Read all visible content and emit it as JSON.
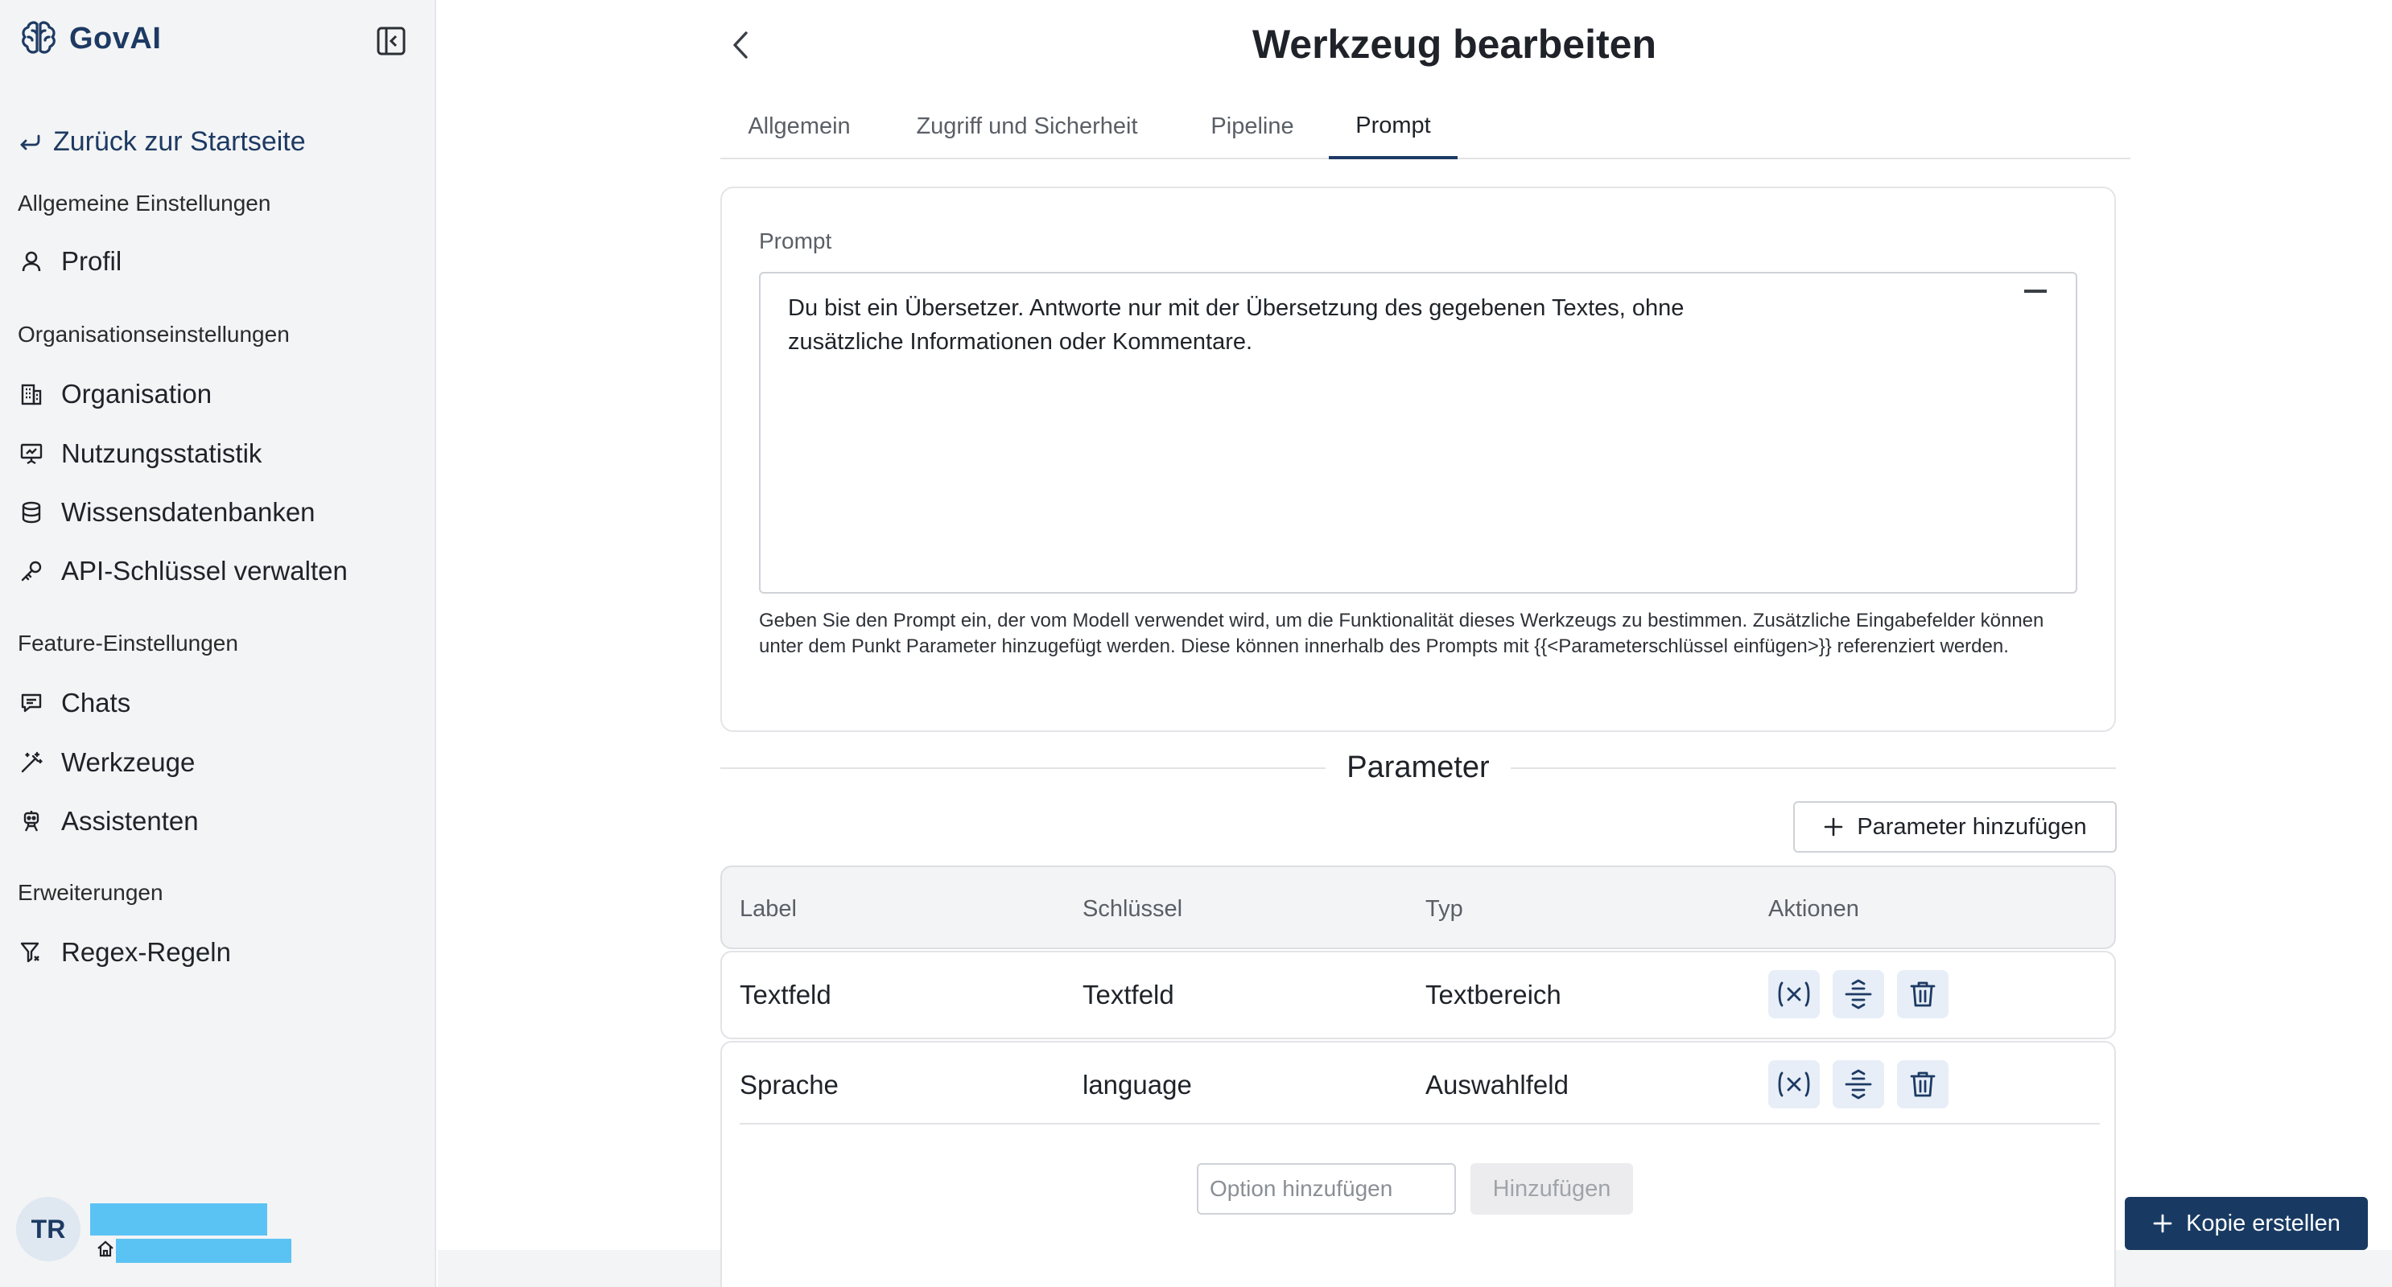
{
  "app": {
    "name": "GovAI"
  },
  "sidebar": {
    "back_label": "Zurück zur Startseite",
    "sections": [
      {
        "title": "Allgemeine Einstellungen",
        "items": [
          {
            "label": "Profil",
            "icon": "user-icon"
          }
        ]
      },
      {
        "title": "Organisationseinstellungen",
        "items": [
          {
            "label": "Organisation",
            "icon": "building-icon"
          },
          {
            "label": "Nutzungsstatistik",
            "icon": "presentation-chart-icon"
          },
          {
            "label": "Wissensdatenbanken",
            "icon": "database-icon"
          },
          {
            "label": "API-Schlüssel verwalten",
            "icon": "key-icon"
          }
        ]
      },
      {
        "title": "Feature-Einstellungen",
        "items": [
          {
            "label": "Chats",
            "icon": "chat-icon"
          },
          {
            "label": "Werkzeuge",
            "icon": "magic-wand-icon"
          },
          {
            "label": "Assistenten",
            "icon": "robot-icon"
          }
        ]
      },
      {
        "title": "Erweiterungen",
        "items": [
          {
            "label": "Regex-Regeln",
            "icon": "filter-icon"
          }
        ]
      }
    ],
    "user": {
      "initials": "TR"
    }
  },
  "header": {
    "title": "Werkzeug bearbeiten"
  },
  "tabs": [
    {
      "label": "Allgemein",
      "active": false
    },
    {
      "label": "Zugriff und Sicherheit",
      "active": false
    },
    {
      "label": "Pipeline",
      "active": false
    },
    {
      "label": "Prompt",
      "active": true
    }
  ],
  "prompt": {
    "label": "Prompt",
    "value": "Du bist ein Übersetzer. Antworte nur mit der Übersetzung des gegebenen Textes, ohne zusätzliche Informationen oder Kommentare.",
    "helper": "Geben Sie den Prompt ein, der vom Modell verwendet wird, um die Funktionalität dieses Werkzeugs zu bestimmen. Zusätzliche Eingabefelder können unter dem Punkt Parameter hinzugefügt werden. Diese können innerhalb des Prompts mit {{<Parameterschlüssel einfügen>}} referenziert werden."
  },
  "parameters": {
    "title": "Parameter",
    "add_label": "Parameter hinzufügen",
    "columns": [
      "Label",
      "Schlüssel",
      "Typ",
      "Aktionen"
    ],
    "rows": [
      {
        "label": "Textfeld",
        "key": "Textfeld",
        "type": "Textbereich"
      },
      {
        "label": "Sprache",
        "key": "language",
        "type": "Auswahlfeld"
      }
    ],
    "option_placeholder": "Option hinzufügen",
    "option_add_label": "Hinzufügen"
  },
  "actions": {
    "copy_label": "Kopie erstellen"
  },
  "colors": {
    "brand": "#1d3a63",
    "primary_button": "#183a62",
    "action_bg": "#e7eef7",
    "redaction": "#5bc3f4"
  }
}
